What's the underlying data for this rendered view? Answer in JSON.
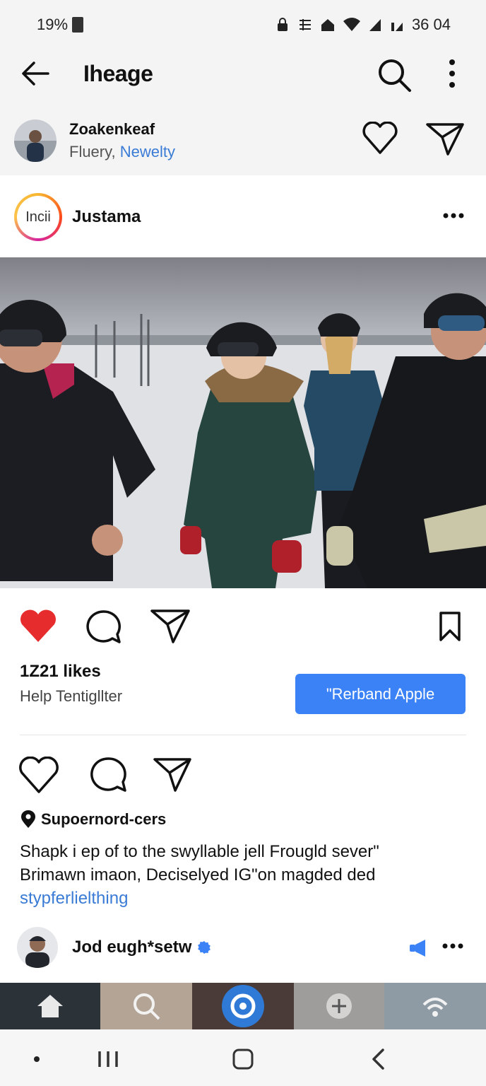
{
  "status_bar": {
    "battery": "19%",
    "time": "36 04"
  },
  "header": {
    "title": "Iheage"
  },
  "account": {
    "name": "Zoakenkeaf",
    "sub_a": "Fluery,",
    "sub_b": "Newelty"
  },
  "post": {
    "avatar_text": "Incii",
    "username": "Justama",
    "likes": "1Z21 likes",
    "help_text": "Help Tentigllter",
    "cta_label": "\"Rerband Apple",
    "location": "Supoernord-cers",
    "caption_line1": "Shapk i ep of to the swyllable jell Frougld sever\"",
    "caption_line2": "Brimawn imaon, Deciselyed IG\"on magded ded",
    "caption_link": "stypferlielthing",
    "commenter": "Jod eugh*setw"
  },
  "colors": {
    "like_red": "#e62c2c",
    "accent_blue": "#3b82f6",
    "link_blue": "#3a7bd5"
  },
  "icons": [
    "back-arrow-icon",
    "search-icon",
    "more-vertical-icon",
    "heart-outline-icon",
    "send-icon",
    "more-horizontal-icon",
    "heart-filled-icon",
    "comment-icon",
    "bookmark-icon",
    "location-pin-icon",
    "verified-badge-icon",
    "megaphone-icon",
    "home-icon"
  ]
}
